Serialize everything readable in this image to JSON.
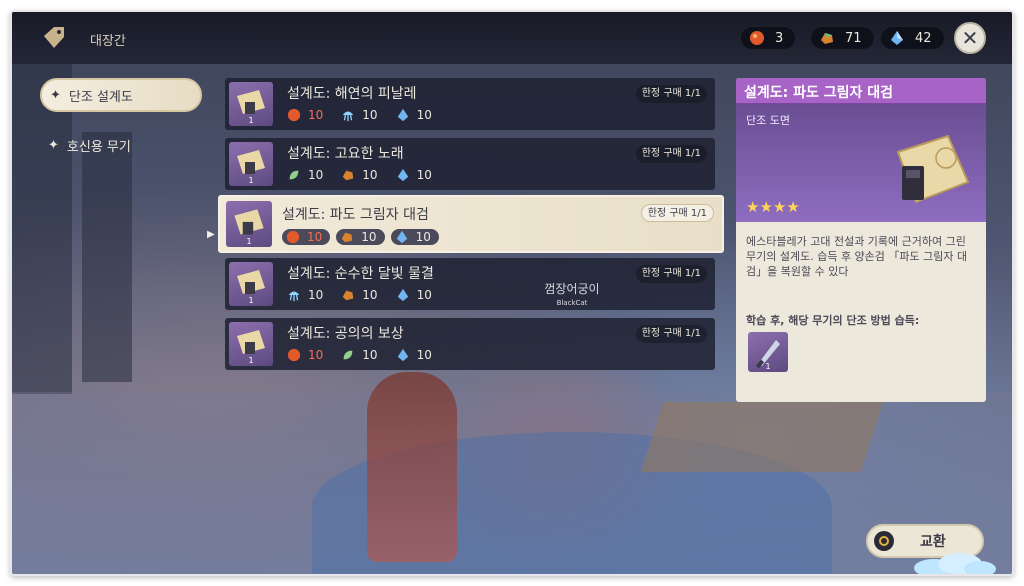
{
  "header": {
    "title": "대장간",
    "icon": "tag-icon",
    "currencies": [
      {
        "icon": "ore-orange-icon",
        "value": "3"
      },
      {
        "icon": "crystal-chunk-icon",
        "value": "71"
      },
      {
        "icon": "crystal-blue-icon",
        "value": "42"
      }
    ],
    "close_icon": "close-icon"
  },
  "tabs": [
    {
      "label": "단조 설계도",
      "active": true
    },
    {
      "label": "호신용 무기",
      "active": false
    }
  ],
  "items": [
    {
      "name": "설계도: 해연의 피날레",
      "limit": "한정 구매 1/1",
      "count": "1",
      "costs": [
        {
          "icon": "ore-orange-icon",
          "value": "10",
          "insufficient": true
        },
        {
          "icon": "jellyfish-icon",
          "value": "10",
          "insufficient": false
        },
        {
          "icon": "crystal-blue-icon",
          "value": "10",
          "insufficient": false
        }
      ]
    },
    {
      "name": "설계도: 고요한 노래",
      "limit": "한정 구매 1/1",
      "count": "1",
      "costs": [
        {
          "icon": "leaf-icon",
          "value": "10",
          "insufficient": false
        },
        {
          "icon": "crystal-chunk-icon",
          "value": "10",
          "insufficient": false
        },
        {
          "icon": "crystal-blue-icon",
          "value": "10",
          "insufficient": false
        }
      ]
    },
    {
      "name": "설계도: 파도 그림자 대검",
      "limit": "한정 구매 1/1",
      "count": "1",
      "selected": true,
      "costs": [
        {
          "icon": "ore-orange-icon",
          "value": "10",
          "insufficient": true
        },
        {
          "icon": "crystal-chunk-icon",
          "value": "10",
          "insufficient": false
        },
        {
          "icon": "crystal-blue-icon",
          "value": "10",
          "insufficient": false
        }
      ]
    },
    {
      "name": "설계도: 순수한 달빛 물결",
      "limit": "한정 구매 1/1",
      "count": "1",
      "costs": [
        {
          "icon": "jellyfish-icon",
          "value": "10",
          "insufficient": false
        },
        {
          "icon": "crystal-chunk-icon",
          "value": "10",
          "insufficient": false
        },
        {
          "icon": "crystal-blue-icon",
          "value": "10",
          "insufficient": false
        }
      ]
    },
    {
      "name": "설계도: 공의의 보상",
      "limit": "한정 구매 1/1",
      "count": "1",
      "costs": [
        {
          "icon": "ore-orange-icon",
          "value": "10",
          "insufficient": true
        },
        {
          "icon": "leaf-icon",
          "value": "10",
          "insufficient": false
        },
        {
          "icon": "crystal-blue-icon",
          "value": "10",
          "insufficient": false
        }
      ]
    }
  ],
  "detail": {
    "title": "설계도: 파도 그림자 대검",
    "type": "단조 도면",
    "stars": "★★★★",
    "description": "에스타블레가 고대 전설과 기록에 근거하여 그린 무기의 설계도. 습득 후 양손검 「파도 그림자 대검」을 복원할 수 있다",
    "learn_label": "학습 후, 해당 무기의 단조 방법 습득:",
    "material_count": "1"
  },
  "exchange": {
    "label": "교환"
  },
  "watermark": {
    "line1": "껌장어궁이",
    "line2": "BlackCat"
  },
  "colors": {
    "accent_purple": "#a764c6",
    "warning": "#ff6a52",
    "star": "#ffd35a"
  }
}
